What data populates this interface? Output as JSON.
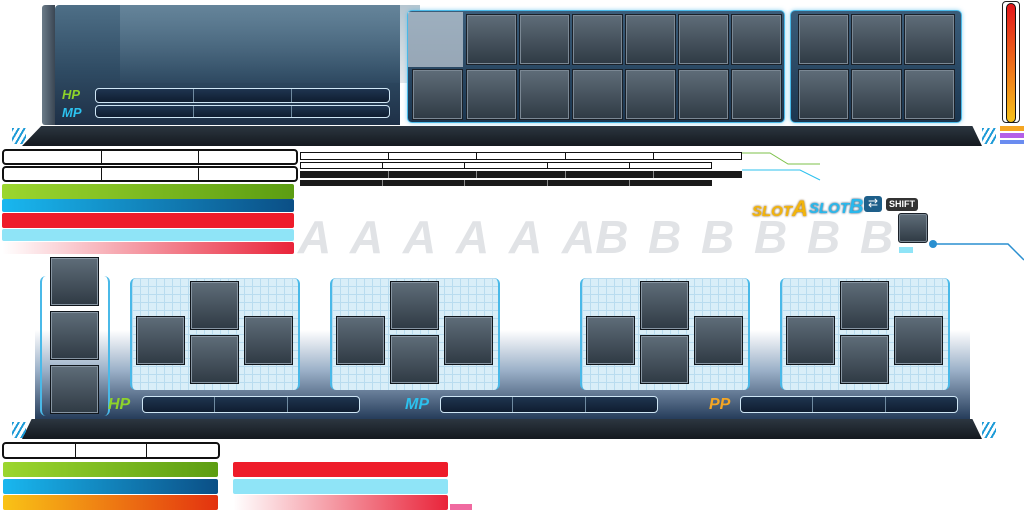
{
  "top_hud": {
    "hp_label": "HP",
    "mp_label": "MP",
    "row1_slots": 10,
    "row2_slots": 11
  },
  "slot_header": {
    "slot_a": "SLOT",
    "slot_a_letter": "A",
    "slot_b": "SLOT",
    "slot_b_letter": "B",
    "shift_key": "SHIFT"
  },
  "slot_assignments": [
    "A",
    "A",
    "A",
    "A",
    "A",
    "AB",
    "B",
    "B",
    "B",
    "B",
    "B"
  ],
  "bottom_hud": {
    "hp_label": "HP",
    "mp_label": "MP",
    "pp_label": "PP"
  },
  "colors": {
    "hp": "#8ed32a",
    "mp": "#2cc1ee",
    "pp": "#f5a623",
    "accent": "#4ab9e8"
  }
}
